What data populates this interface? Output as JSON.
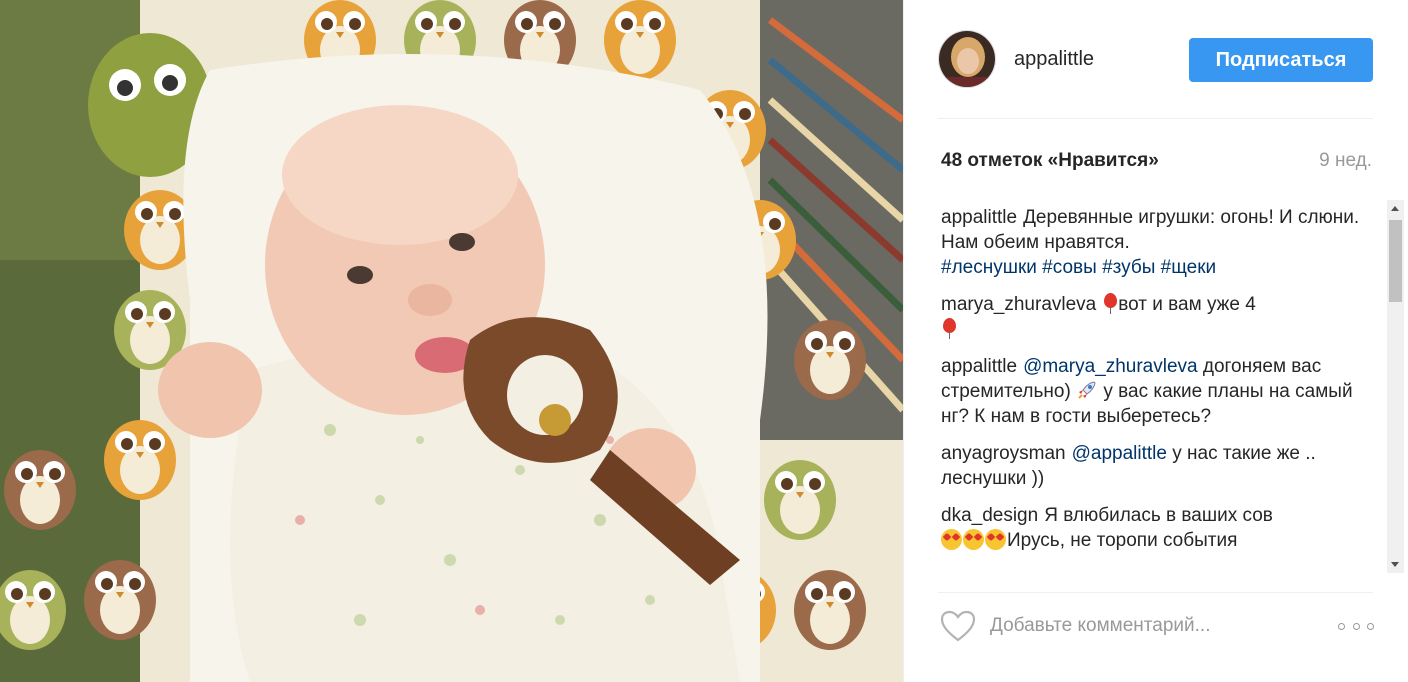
{
  "post": {
    "username": "appalittle",
    "follow_label": "Подписаться",
    "likes": "48 отметок «Нравится»",
    "time": "9 нед."
  },
  "comments": [
    {
      "author": "appalittle",
      "text": "Деревянные игрушки: огонь! И слюни. Нам обеим нравятся.",
      "tags": [
        "#леснушки",
        "#совы",
        "#зубы",
        "#щеки"
      ]
    },
    {
      "author": "marya_zhuravleva",
      "text": "вот и вам уже 4"
    },
    {
      "author": "appalittle",
      "mention": "@marya_zhuravleva",
      "text_a": "догоняем вас стремительно)",
      "text_b": "у вас какие планы на самый нг? К нам в гости выберетесь?"
    },
    {
      "author": "anyagroysman",
      "mention": "@appalittle",
      "text": "у нас такие же .. леснушки ))"
    },
    {
      "author": "dka_design",
      "text": "Я влюбилась в ваших сов",
      "text_b": "Ирусь, не торопи события"
    }
  ],
  "footer": {
    "comment_placeholder": "Добавьте комментарий..."
  },
  "icons": {
    "like": "heart-icon",
    "more": "more-options-icon"
  },
  "colors": {
    "accent": "#3897f0",
    "link": "#003569",
    "muted": "#999999"
  }
}
